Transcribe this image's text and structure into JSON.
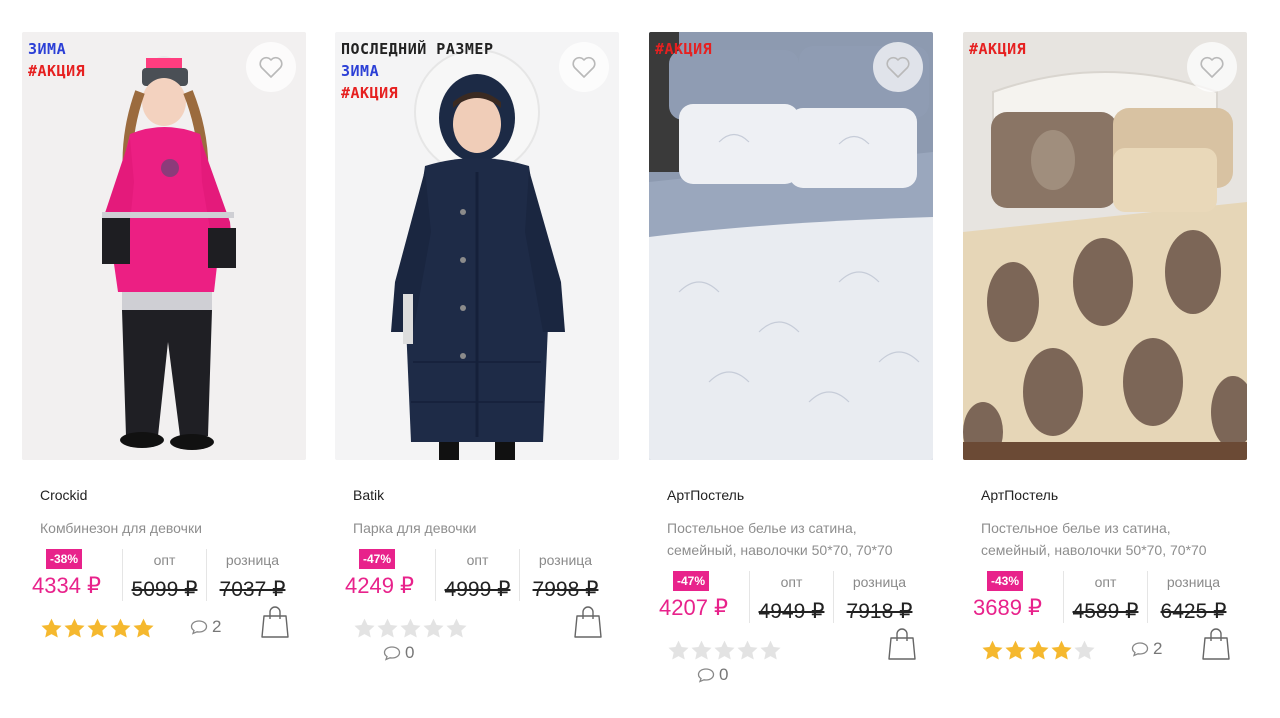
{
  "products": [
    {
      "badges": [
        {
          "text": "ЗИМА",
          "color": "#2b3fd6"
        },
        {
          "text": "#АКЦИЯ",
          "color": "#e62020"
        }
      ],
      "brand": "Crockid",
      "title": "Комбинезон для девочки",
      "discount": "-38%",
      "price_now": "4334 ₽",
      "opt_label": "опт",
      "opt_price": "5099 ₽",
      "retail_label": "розница",
      "retail_price": "7037 ₽",
      "rating": 5,
      "comments": "2",
      "photo_type": "pink-snowsuit"
    },
    {
      "badges": [
        {
          "text": "ПОСЛЕДНИЙ РАЗМЕР",
          "color": "#222222"
        },
        {
          "text": "ЗИМА",
          "color": "#2b3fd6"
        },
        {
          "text": "#АКЦИЯ",
          "color": "#e62020"
        }
      ],
      "brand": "Batik",
      "title": "Парка для девочки",
      "discount": "-47%",
      "price_now": "4249 ₽",
      "opt_label": "опт",
      "opt_price": "4999 ₽",
      "retail_label": "розница",
      "retail_price": "7998 ₽",
      "rating": 0,
      "comments": "0",
      "photo_type": "navy-parka"
    },
    {
      "badges": [
        {
          "text": "#АКЦИЯ",
          "color": "#e62020"
        }
      ],
      "brand": "АртПостель",
      "title": "Постельное белье из сатина, семейный, наволочки 50*70, 70*70",
      "discount": "-47%",
      "price_now": "4207 ₽",
      "opt_label": "опт",
      "opt_price": "4949 ₽",
      "retail_label": "розница",
      "retail_price": "7918 ₽",
      "rating": 0,
      "comments": "0",
      "photo_type": "grey-bedding"
    },
    {
      "badges": [
        {
          "text": "#АКЦИЯ",
          "color": "#e62020"
        }
      ],
      "brand": "АртПостель",
      "title": "Постельное белье из сатина, семейный, наволочки 50*70, 70*70",
      "discount": "-43%",
      "price_now": "3689 ₽",
      "opt_label": "опт",
      "opt_price": "4589 ₽",
      "retail_label": "розница",
      "retail_price": "6425 ₽",
      "rating": 4,
      "comments": "2",
      "photo_type": "beige-damask-bedding"
    }
  ],
  "colors": {
    "accent": "#e8228b",
    "star_filled": "#f5b82e",
    "star_empty": "#e3e3e3"
  },
  "icons": {
    "wishlist": "heart-icon",
    "comments": "speech-bubble-icon",
    "cart": "shopping-bag-icon",
    "rating": "star-icon"
  }
}
